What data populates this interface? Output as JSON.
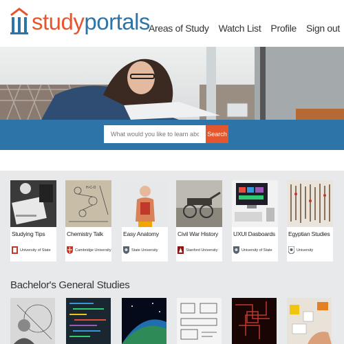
{
  "header": {
    "logo": {
      "study": "study",
      "portals": "portals"
    },
    "nav": [
      "Areas of Study",
      "Watch List",
      "Profile",
      "Sign out"
    ]
  },
  "search": {
    "placeholder": "What would you like to learn about?",
    "button_label": "Search"
  },
  "colors": {
    "brand_blue": "#2d74a9",
    "brand_orange": "#e4572e",
    "section_bg": "#e8e9ea"
  },
  "courses": [
    {
      "title": "Studying Tips",
      "university": "University of State",
      "crest": "red-crest-icon"
    },
    {
      "title": "Chemistry Talk",
      "university": "Cambridge University",
      "crest": "red-shield-icon"
    },
    {
      "title": "Easy Anatomy",
      "university": "State University",
      "crest": "gray-shield-icon"
    },
    {
      "title": "Civil War History",
      "university": "Stanford University",
      "crest": "red-crest-icon"
    },
    {
      "title": "UXUI Dasboards",
      "university": "University of State",
      "crest": "gray-shield-icon"
    },
    {
      "title": "Egyptian Studies",
      "university": "University",
      "crest": "gray-circle-shield-icon"
    }
  ],
  "bachelor_section": {
    "title": "Bachelor's General Studies"
  }
}
